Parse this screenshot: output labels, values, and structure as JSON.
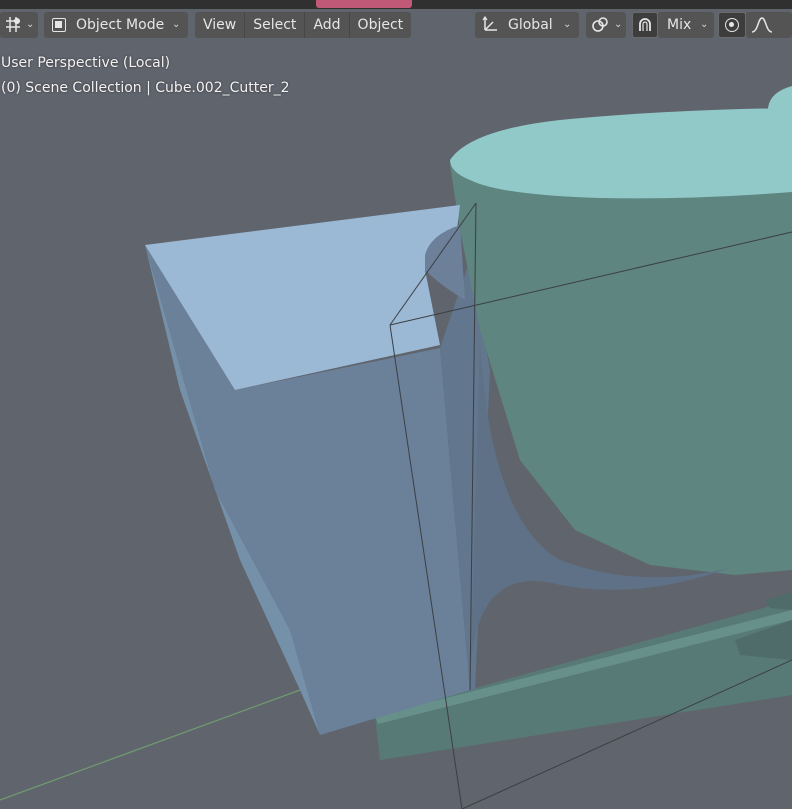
{
  "header": {
    "editor_type_icon": "transform-pivot-icon",
    "mode": {
      "icon": "object-mode-icon",
      "label": "Object Mode"
    },
    "menus": [
      "View",
      "Select",
      "Add",
      "Object"
    ],
    "orientation": {
      "icon": "transform-orientation-icon",
      "label": "Global"
    },
    "snap_icon": "link-snap-icon",
    "proportional_icon": "magnet-icon",
    "shading": {
      "label": "Mix"
    },
    "pivot_icon": "dot-pivot-icon",
    "falloff_icon": "falloff-curve-icon"
  },
  "overlay": {
    "view_name": "User Perspective (Local)",
    "collection_line": "(0) Scene Collection | Cube.002_Cutter_2"
  },
  "colors": {
    "viewport_bg": "#60646d",
    "header_button": "#545454",
    "cube_top": "#9ab8d3",
    "cube_front": "#6a7f96",
    "cup_top": "#90c8c9",
    "cup_side": "#5f8680",
    "grid_axis_y": "#6f9c6f",
    "topbar_tab_accent": "#c05877"
  }
}
